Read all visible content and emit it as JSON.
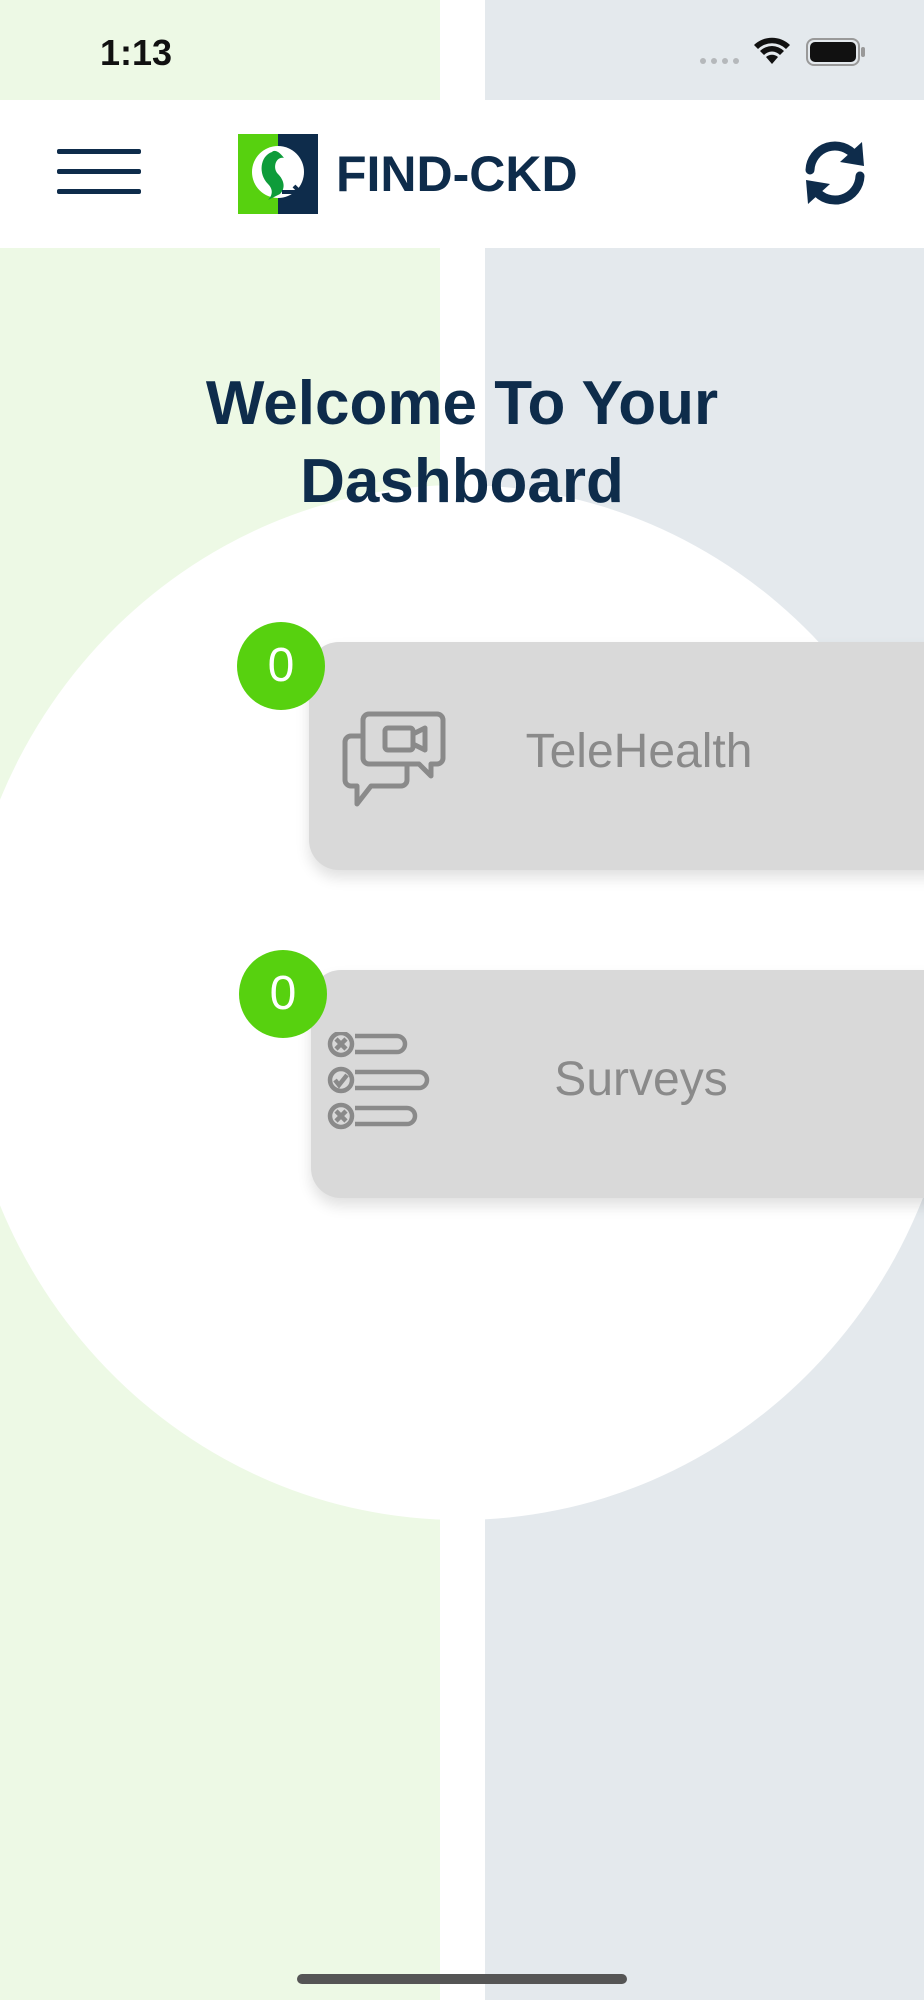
{
  "status_bar": {
    "time": "1:13"
  },
  "header": {
    "logo_text": "FIND-CKD",
    "menu_icon": "hamburger-menu-icon",
    "refresh_icon": "refresh-icon"
  },
  "page": {
    "title_line1": "Welcome To Your",
    "title_line2": "Dashboard"
  },
  "cards": [
    {
      "label": "TeleHealth",
      "badge": "0",
      "icon": "video-chat-icon"
    },
    {
      "label": "Surveys",
      "badge": "0",
      "icon": "survey-checklist-icon"
    }
  ],
  "colors": {
    "primary": "#0e2c4b",
    "accent_green": "#57d10f",
    "card_bg": "#d9d9d9",
    "card_text": "#8a8a8a",
    "bg_left": "#edf9e5",
    "bg_right": "#e4e9ed"
  }
}
